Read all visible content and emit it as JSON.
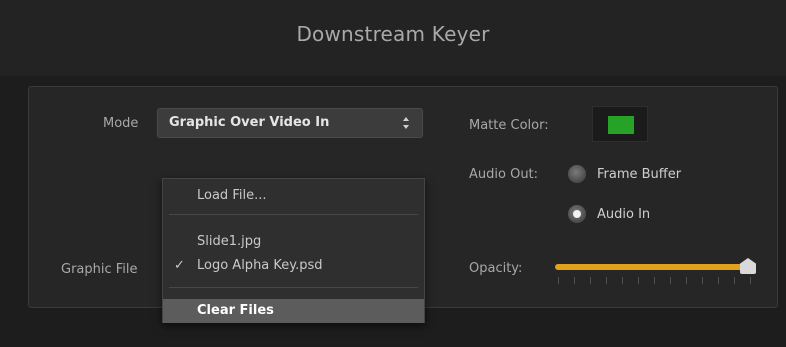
{
  "header": {
    "title": "Downstream Keyer"
  },
  "mode": {
    "label": "Mode",
    "value": "Graphic Over Video In",
    "arrows": "▲▼"
  },
  "graphic_file": {
    "label": "Graphic File"
  },
  "matte": {
    "label": "Matte Color:",
    "color": "#26a326"
  },
  "audio_out": {
    "label": "Audio Out:",
    "options": [
      {
        "label": "Frame Buffer",
        "selected": false
      },
      {
        "label": "Audio In",
        "selected": true
      }
    ]
  },
  "opacity": {
    "label": "Opacity:",
    "value": 1.0,
    "accent": "#e0a21c"
  },
  "menu": {
    "load": "Load File...",
    "files": [
      {
        "label": "Slide1.jpg",
        "checked": false
      },
      {
        "label": "Logo Alpha Key.psd",
        "checked": true
      }
    ],
    "check_mark": "✓",
    "clear": "Clear Files"
  }
}
